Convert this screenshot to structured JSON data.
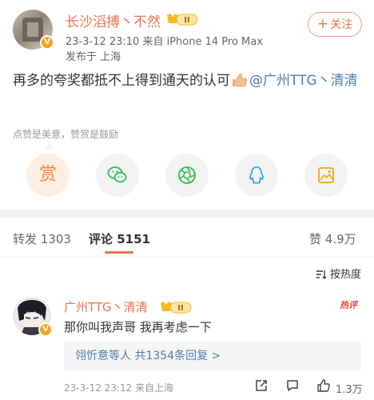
{
  "post": {
    "author": "长沙滔搏丶不然",
    "author_level": "II",
    "meta_line1": "23-3-12 23:10  来自 iPhone 14 Pro Max",
    "meta_line2": "发布于 上海",
    "follow_label": "关注",
    "text_before": "再多的夸奖都抵不上得到通天的认可",
    "mention": "@广州TTG丶清清"
  },
  "reward": {
    "tip": "点赞是美意，赞赏是鼓励",
    "reward_label": "赏",
    "share_icons": [
      "reward-icon",
      "wechat-icon",
      "moments-icon",
      "qq-icon",
      "save-image-icon"
    ]
  },
  "tabs": {
    "repost_label": "转发",
    "repost_count": "1303",
    "comment_label": "评论",
    "comment_count": "5151",
    "like_label": "赞",
    "like_count": "4.9万"
  },
  "sort": {
    "label": "按热度"
  },
  "comment": {
    "author": "广州TTG丶清清",
    "author_level": "II",
    "hot_tag": "热评",
    "text": "那你叫我声哥 我再考虑一下",
    "reply_summary": "翎忻意等人  共1354条回复 >",
    "meta": "23-3-12 23:12  来自上海",
    "like_count": "1.3万"
  },
  "colors": {
    "accent": "#eb7350",
    "link": "#507daf",
    "vip": "#f7a21d"
  }
}
